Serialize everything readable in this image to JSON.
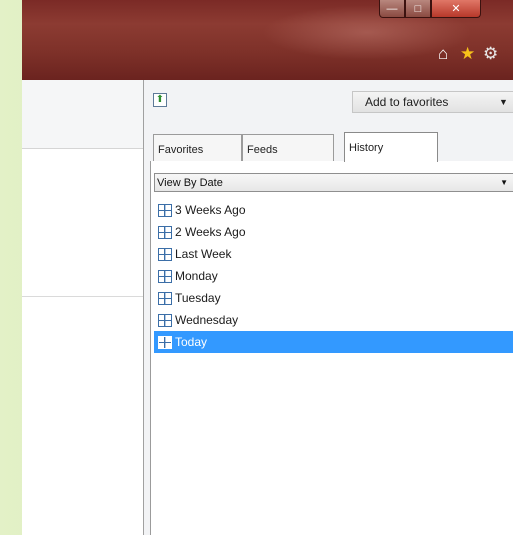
{
  "window_controls": {
    "minimize": "—",
    "maximize": "□",
    "close": "✕"
  },
  "icons": {
    "home": "⌂",
    "favorites_star": "★",
    "settings": "⚙",
    "pin": "⬆"
  },
  "favorites_center": {
    "add_to_favorites_label": "Add to favorites",
    "dropdown_arrow": "▼",
    "tabs": [
      {
        "label": "Favorites"
      },
      {
        "label": "Feeds"
      },
      {
        "label": "History"
      }
    ],
    "view_select": {
      "value": "View By Date",
      "arrow": "▼"
    },
    "history_items": [
      {
        "label": "3 Weeks Ago"
      },
      {
        "label": "2 Weeks Ago"
      },
      {
        "label": "Last Week"
      },
      {
        "label": "Monday"
      },
      {
        "label": "Tuesday"
      },
      {
        "label": "Wednesday"
      },
      {
        "label": "Today"
      }
    ]
  }
}
